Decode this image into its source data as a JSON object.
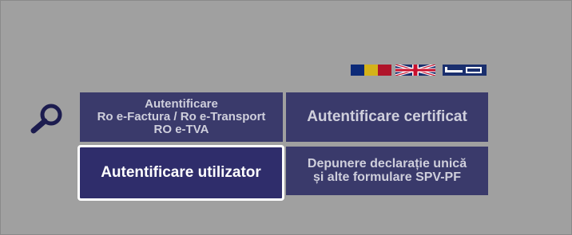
{
  "languages": [
    {
      "name": "ro-flag-icon",
      "colors": [
        "#0c2a78",
        "#d4b21a",
        "#b0142a"
      ]
    },
    {
      "name": "uk-flag-icon",
      "colors": [
        "#1a2f6e",
        "#ffffff",
        "#c8102e"
      ]
    },
    {
      "name": "extra-flag-icon",
      "colors": [
        "#1a2f6e",
        "#ffffff"
      ]
    }
  ],
  "search": {
    "icon": "magnifier-icon",
    "color": "#1c1c4f"
  },
  "buttons": {
    "ro_efactura": {
      "line1": "Autentificare",
      "line2": "Ro e-Factura / Ro e-Transport",
      "line3": "RO e-TVA"
    },
    "certificat": "Autentificare certificat",
    "utilizator": "Autentificare utilizator",
    "depunere": {
      "line1": "Depunere declarație unică",
      "line2": "și alte formulare SPV-PF"
    }
  },
  "colors": {
    "background": "#a0a0a0",
    "button_bg": "#3a3a6b",
    "button_text": "#cfcfdc",
    "active_button_bg": "#2f2d6b",
    "active_border": "#ffffff"
  }
}
